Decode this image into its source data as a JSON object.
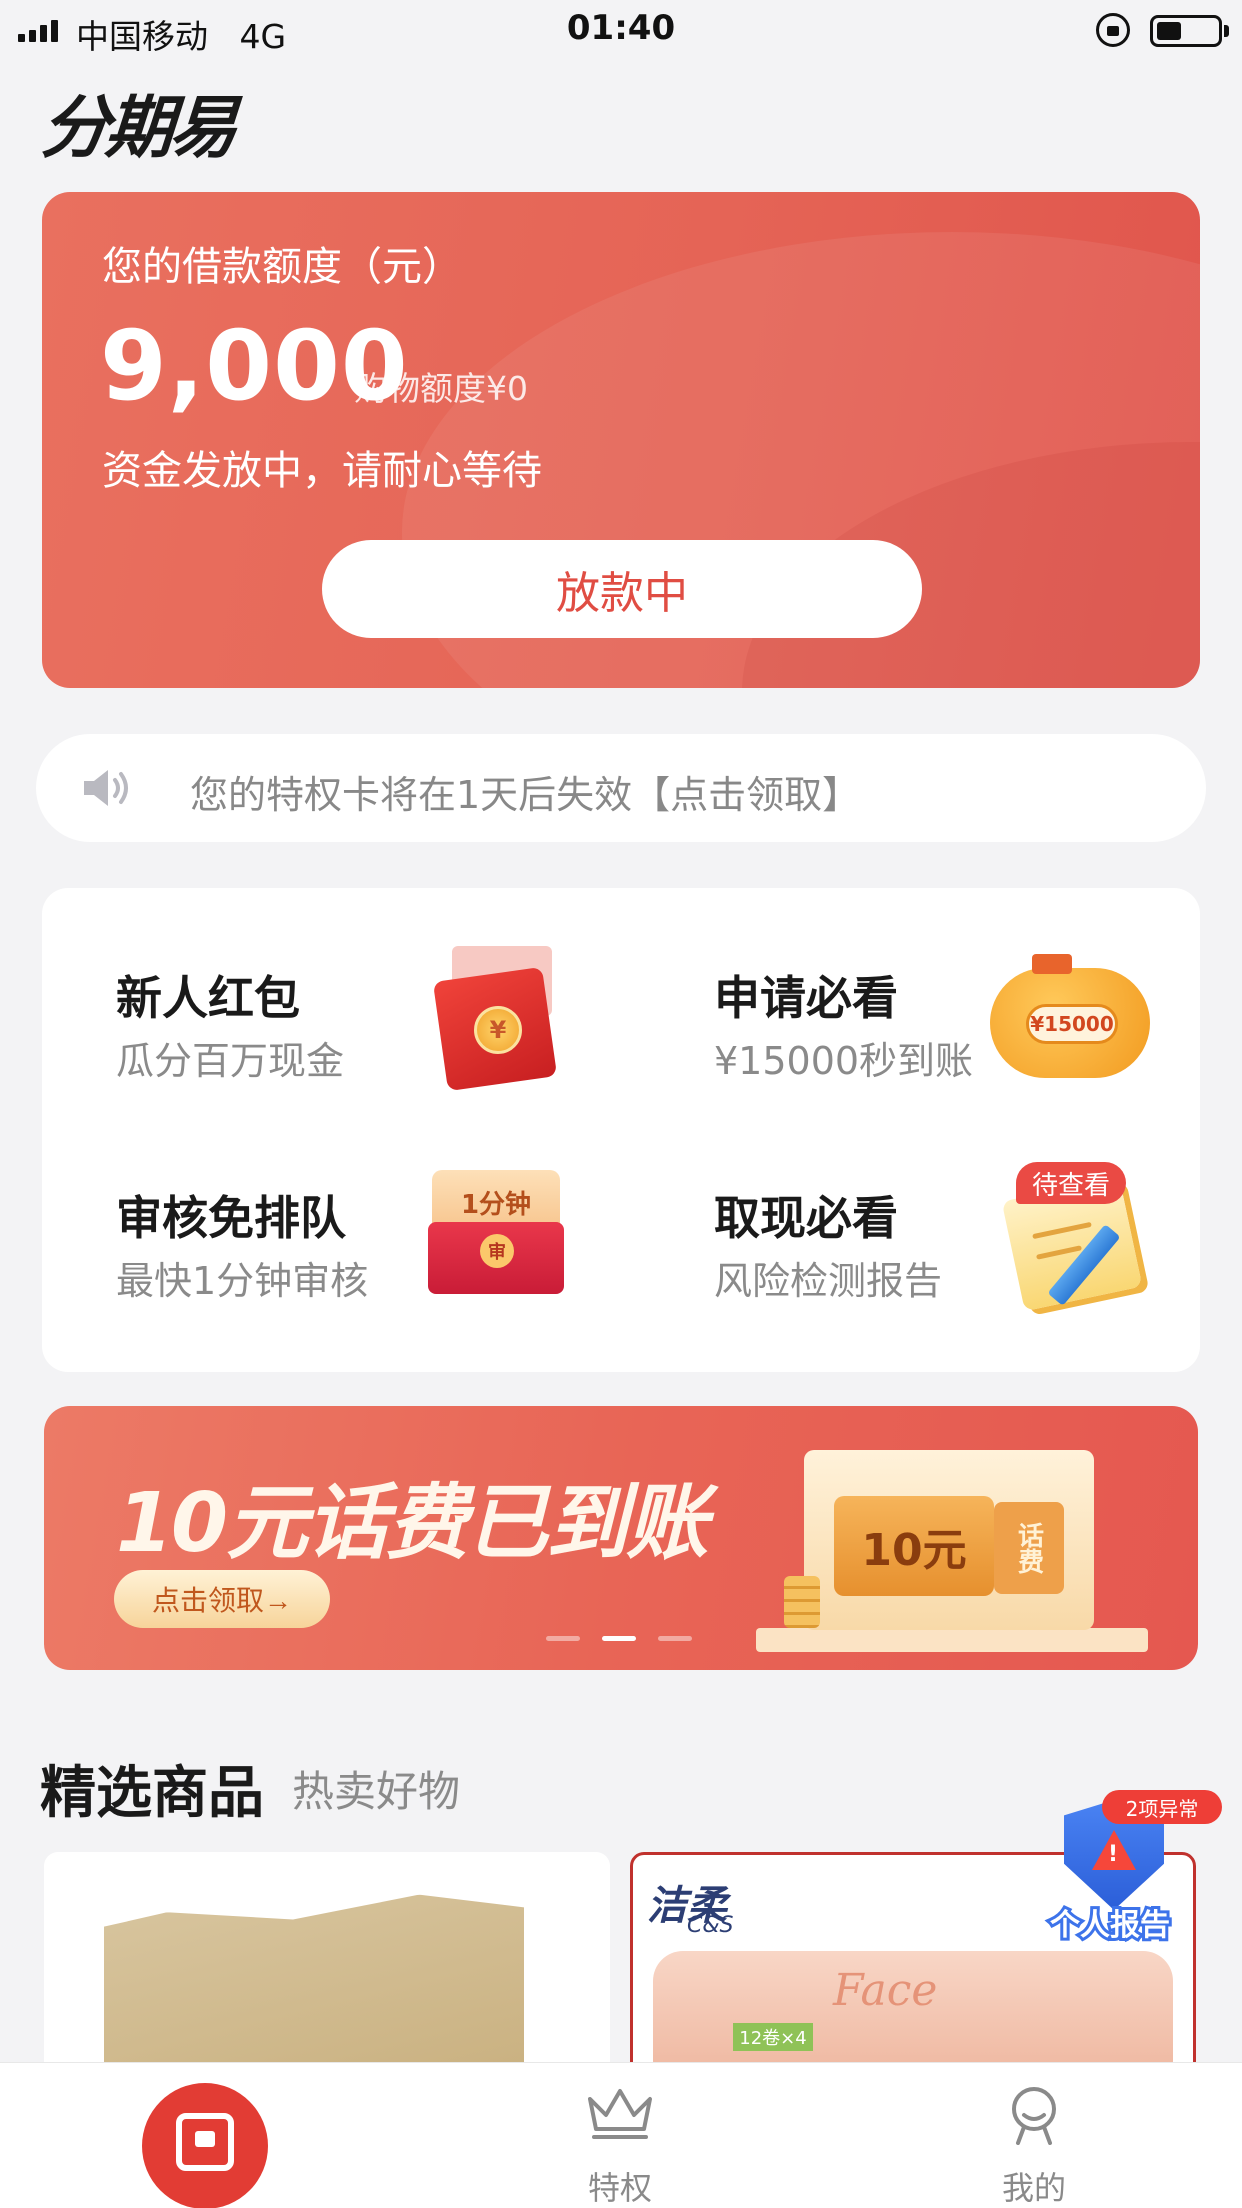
{
  "status_bar": {
    "carrier": "中国移动",
    "network": "4G",
    "time": "01:40",
    "battery_level": 0.4
  },
  "header": {
    "logo_text": "分期易"
  },
  "credit_card": {
    "label": "您的借款额度（元）",
    "amount": "9,000",
    "shopping_limit": "购物额度¥0",
    "status": "资金发放中，请耐心等待",
    "button_label": "放款中",
    "accent_color": "#e56456"
  },
  "notice": {
    "text": "您的特权卡将在1天后失效【点击领取】",
    "icon": "speaker-icon"
  },
  "features": [
    {
      "title": "新人红包",
      "subtitle": "瓜分百万现金",
      "icon": "red-envelope-icon",
      "icon_text": "¥"
    },
    {
      "title": "申请必看",
      "subtitle": "¥15000秒到账",
      "icon": "piggy-bank-icon",
      "icon_text": "¥15000"
    },
    {
      "title": "审核免排队",
      "subtitle": "最快1分钟审核",
      "icon": "envelope-icon",
      "icon_text": "1分钟",
      "icon_seal": "审"
    },
    {
      "title": "取现必看",
      "subtitle": "风险检测报告",
      "icon": "notepad-icon",
      "badge": "待查看"
    }
  ],
  "banner": {
    "title": "10元话费已到账",
    "button_label": "点击领取→",
    "ticket_text": "10元",
    "ticket_side_text": "话费",
    "slide_count": 3,
    "active_slide": 2
  },
  "products_section": {
    "title": "精选商品",
    "subtitle": "热卖好物",
    "products": [
      {
        "image": "tissue-product-image"
      },
      {
        "brand": "洁柔",
        "brand_en": "C&S",
        "product_name": "Face",
        "pack_label": "12卷×4"
      }
    ]
  },
  "report": {
    "badge": "2项异常",
    "label": "个人报告"
  },
  "tabbar": {
    "items": [
      {
        "label": "",
        "icon": "home-logo-icon",
        "active": true
      },
      {
        "label": "特权",
        "icon": "crown-icon"
      },
      {
        "label": "我的",
        "icon": "user-icon"
      }
    ]
  }
}
